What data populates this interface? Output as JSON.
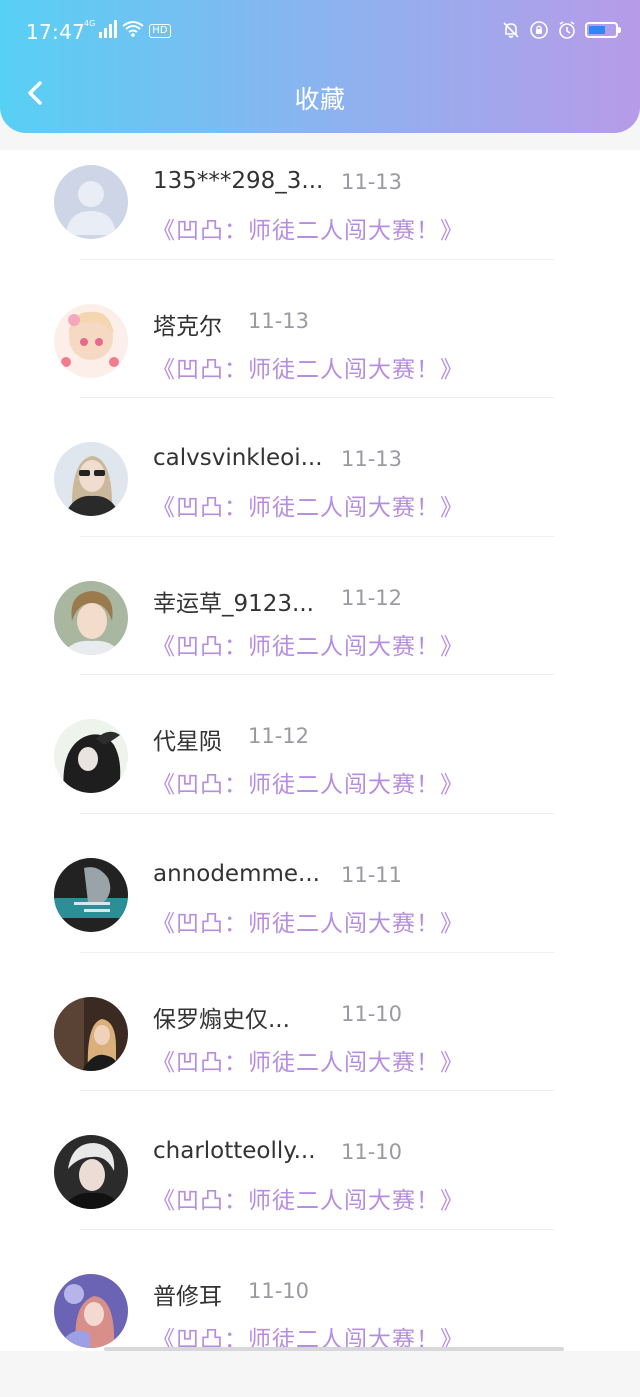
{
  "status_bar": {
    "time": "17:47",
    "network": "4G",
    "hd": "HD"
  },
  "header": {
    "title": "收藏"
  },
  "colors": {
    "gradient_start": "#57d0f4",
    "gradient_end": "#b79be8",
    "book_title": "#b68ee0",
    "date": "#9a9aa3"
  },
  "list": [
    {
      "name": "135***298_3...",
      "date": "11-13",
      "title": "《凹凸：师徒二人闯大赛！》",
      "avatar": "default-avatar"
    },
    {
      "name": "塔克尔",
      "date": "11-13",
      "title": "《凹凸：师徒二人闯大赛！》",
      "avatar": "anime-girl"
    },
    {
      "name": "calvsvinkleoi...",
      "date": "11-13",
      "title": "《凹凸：师徒二人闯大赛！》",
      "avatar": "sunglasses-person"
    },
    {
      "name": "幸运草_9123...",
      "date": "11-12",
      "title": "《凹凸：师徒二人闯大赛！》",
      "avatar": "young-man"
    },
    {
      "name": "代星陨",
      "date": "11-12",
      "title": "《凹凸：师徒二人闯大赛！》",
      "avatar": "dark-anime"
    },
    {
      "name": "annodemme...",
      "date": "11-11",
      "title": "《凹凸：师徒二人闯大赛！》",
      "avatar": "teal-anime"
    },
    {
      "name": "保罗煽史仅...",
      "date": "11-10",
      "title": "《凹凸：师徒二人闯大赛！》",
      "avatar": "cafe-girl"
    },
    {
      "name": "charlotteolly...",
      "date": "11-10",
      "title": "《凹凸：师徒二人闯大赛！》",
      "avatar": "portrait"
    },
    {
      "name": "普修耳",
      "date": "11-10",
      "title": "《凹凸：师徒二人闯大赛！》",
      "avatar": "purple-anime"
    }
  ]
}
